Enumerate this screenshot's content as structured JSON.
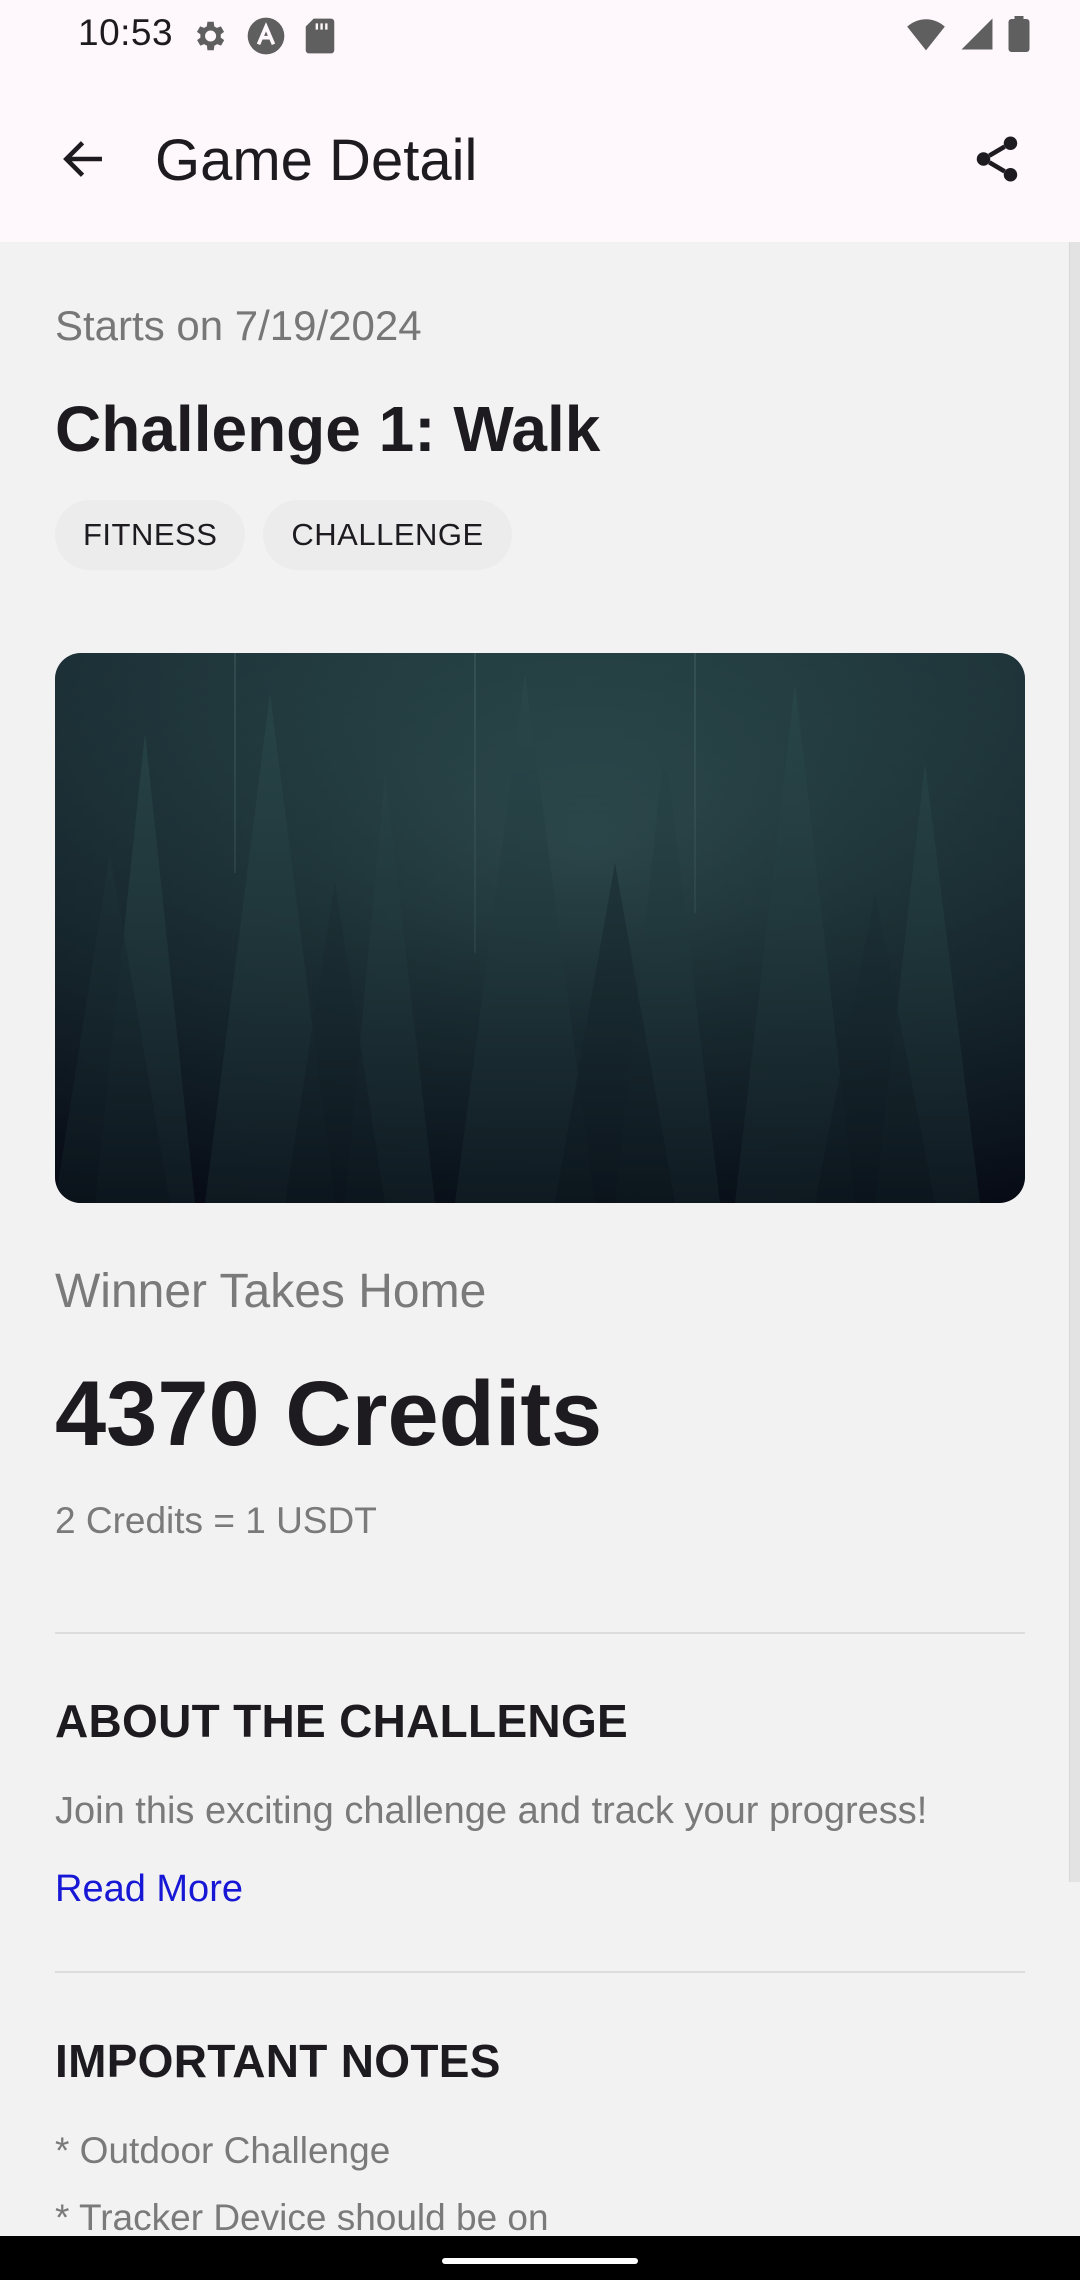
{
  "status_bar": {
    "time": "10:53",
    "left_icons": [
      "settings-icon",
      "a-badge-icon",
      "sd-card-icon"
    ],
    "right_icons": [
      "wifi-icon",
      "signal-icon",
      "battery-icon"
    ]
  },
  "app_bar": {
    "title": "Game Detail",
    "back_icon": "arrow-back-icon",
    "share_icon": "share-icon"
  },
  "game": {
    "start_date": "Starts on 7/19/2024",
    "title": "Challenge 1: Walk",
    "tags": [
      "FITNESS",
      "CHALLENGE"
    ],
    "prize_label": "Winner Takes Home",
    "prize_amount": "4370 Credits",
    "conversion": "2 Credits = 1 USDT"
  },
  "about": {
    "heading": "ABOUT THE CHALLENGE",
    "text": "Join this exciting challenge and track your progress!",
    "read_more": "Read More"
  },
  "notes": {
    "heading": "IMPORTANT NOTES",
    "items": [
      "* Outdoor Challenge",
      "* Tracker Device should be on"
    ]
  },
  "colors": {
    "app_bar_bg": "#fef7fb",
    "content_bg": "#f2f2f2",
    "link": "#1717d6",
    "text_primary": "#1d1b20",
    "text_secondary": "#7a7a7a"
  }
}
